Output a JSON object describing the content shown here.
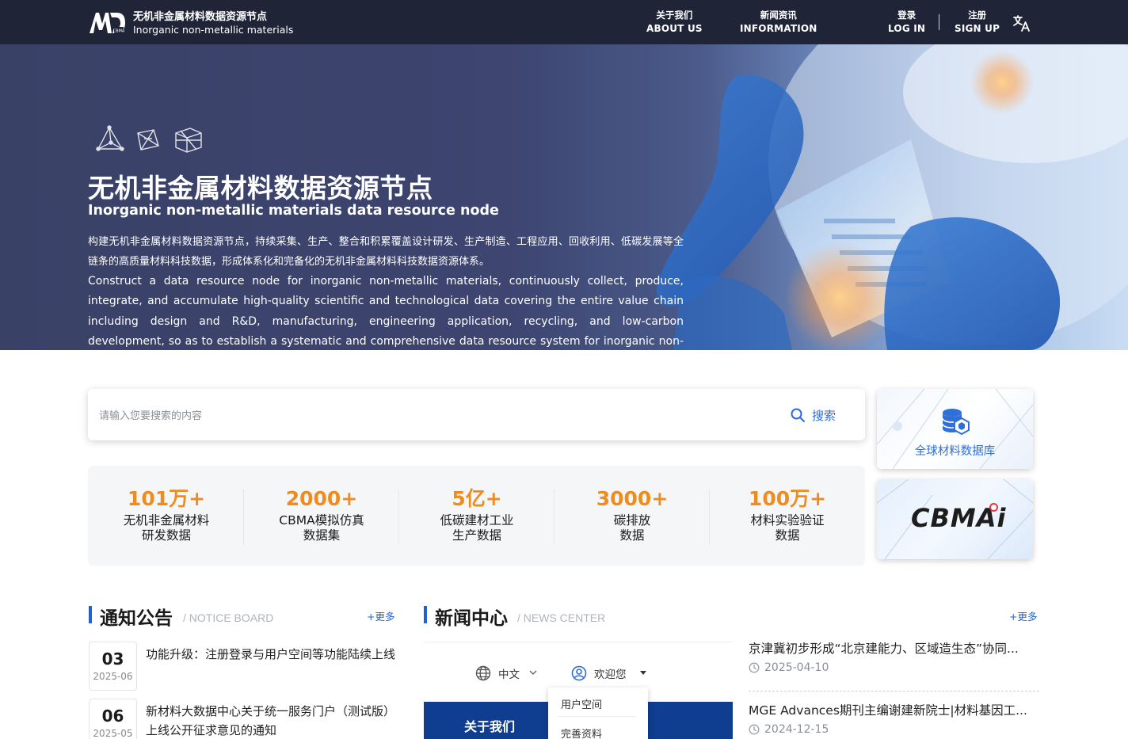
{
  "header": {
    "site_name_cn": "无机非金属材料数据资源节点",
    "site_name_en": "Inorganic non-metallic materials",
    "nav": [
      {
        "cn": "关于我们",
        "en": "ABOUT US"
      },
      {
        "cn": "新闻资讯",
        "en": "INFORMATION"
      },
      {
        "cn": "登录",
        "en": "LOG IN"
      },
      {
        "cn": "注册",
        "en": "SIGN UP"
      }
    ]
  },
  "hero": {
    "title_cn": "无机非金属材料数据资源节点",
    "title_en": "Inorganic non-metallic materials data resource node",
    "desc_cn": "构建无机非金属材料数据资源节点，持续采集、生产、整合和积累覆盖设计研发、生产制造、工程应用、回收利用、低碳发展等全链条的高质量材料科技数据，形成体系化和完备化的无机非金属材料科技数据资源体系。",
    "desc_en": "Construct a data resource node for inorganic non-metallic materials, continuously collect, produce, integrate, and accumulate high-quality scientific and technological data covering the entire value chain including design and R&D, manufacturing, engineering application, recycling, and low-carbon development, so as to establish a systematic and comprehensive data resource system for inorganic non-metallic materials."
  },
  "search": {
    "placeholder": "请输入您要搜索的内容",
    "button_label": "搜索"
  },
  "stats": [
    {
      "value": "101万+",
      "label_line1": "无机非金属材料",
      "label_line2": "研发数据"
    },
    {
      "value": "2000+",
      "label_line1": "CBMA模拟仿真",
      "label_line2": "数据集"
    },
    {
      "value": "5亿+",
      "label_line1": "低碳建材工业",
      "label_line2": "生产数据"
    },
    {
      "value": "3000+",
      "label_line1": "碳排放",
      "label_line2": "数据"
    },
    {
      "value": "100万+",
      "label_line1": "材料实验验证",
      "label_line2": "数据"
    }
  ],
  "side_cards": {
    "database_label": "全球材料数据库",
    "cbmai_text": "CBMAi"
  },
  "notice_board": {
    "title": "通知公告",
    "subtitle": "/ NOTICE BOARD",
    "more": "+更多",
    "items": [
      {
        "day": "03",
        "year_month": "2025-06",
        "text": "功能升级：注册登录与用户空间等功能陆续上线"
      },
      {
        "day": "06",
        "year_month": "2025-05",
        "text": "新材料大数据中心关于统一服务门户（测试版）上线公开征求意见的通知"
      }
    ]
  },
  "news_center": {
    "title": "新闻中心",
    "subtitle": "/ NEWS CENTER",
    "more": "+更多",
    "image": {
      "lang": "中文",
      "welcome": "欢迎您",
      "banner_text": "关于我们",
      "menu": [
        "用户空间",
        "完善资料"
      ]
    },
    "items": [
      {
        "title": "京津冀初步形成“北京建能力、区域造生态”协同...",
        "date": "2025-04-10"
      },
      {
        "title": "MGE Advances期刊主编谢建新院士|材料基因工...",
        "date": "2024-12-15"
      }
    ]
  },
  "colors": {
    "header_bg": "#1f2537",
    "accent_blue": "#1f62d6",
    "stat_orange": "#f08c1e"
  }
}
